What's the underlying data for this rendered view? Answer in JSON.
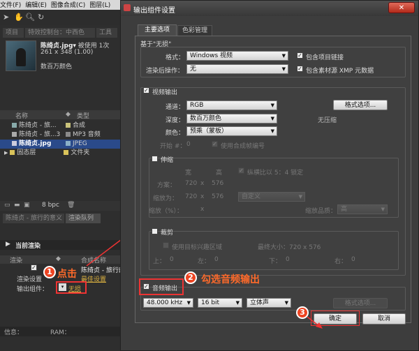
{
  "menubar": {
    "items": [
      "文件(F)",
      "编辑(E)",
      "图像合成(C)",
      "图层(L)"
    ]
  },
  "project": {
    "tabs": [
      "项目",
      "特效控制台：中西色",
      "工具"
    ],
    "file_name": "陈绮贞.jpg",
    "used_text": "被使用 1次",
    "dimensions": "261 x 348 (1.00)",
    "color_depth": "数百万颜色",
    "columns": {
      "name": "名称",
      "type": "类型"
    },
    "items": [
      {
        "name": "陈绮贞 - 旅...",
        "type": "合成",
        "color": "#c9c27a"
      },
      {
        "name": "陈绮贞 - 旅...3",
        "type": "MP3 音频",
        "color": "#8a8a8a"
      },
      {
        "name": "陈绮贞.jpg",
        "type": "JPEG",
        "color": "#8ab0c8"
      },
      {
        "name": "固态层",
        "type": "文件夹",
        "color": "#d9c35a"
      }
    ],
    "bpc": "8 bpc"
  },
  "render_queue": {
    "tabs": [
      "陈绮贞 - 旅行的意义",
      "渲染队列"
    ],
    "current_render": "当前渲染",
    "col_render": "渲染",
    "col_comp": "合成名称",
    "comp_name": "陈绮贞 - 旅行的",
    "render_settings_label": "渲染设置",
    "render_settings_value": "最佳设置",
    "output_module_label": "输出组件：",
    "output_module_value": "无损",
    "info_label": "信息：",
    "ram_label": "RAM："
  },
  "dialog": {
    "title": "输出组件设置",
    "close": "✕",
    "tabs": [
      "主要选项",
      "色彩管理"
    ],
    "based_on": "基于\"无损\"",
    "format_label": "格式：",
    "format_value": "Windows 视频",
    "include_project_link": "包含项目链接",
    "post_render_label": "渲染后操作：",
    "post_render_value": "无",
    "include_xmp": "包含素材源 XMP 元数据",
    "video_output": "视频输出",
    "channels_label": "通道：",
    "channels_value": "RGB",
    "format_options": "格式选项...",
    "depth_label": "深度：",
    "depth_value": "数百万颜色",
    "no_compression": "无压缩",
    "color_label": "颜色：",
    "color_value": "预乘（蒙板）",
    "start_label": "开始 #：",
    "start_value": "0",
    "use_comp_frame": "使用合成帧编号",
    "stretch": "伸缩",
    "width_label": "宽",
    "height_label": "高",
    "lock_ratio": "纵横比以 5：4 锁定",
    "render_at_label": "方案：",
    "render_at_w": "720",
    "render_at_h": "576",
    "stretch_to_label": "缩放为：",
    "stretch_to_w": "720",
    "stretch_to_h": "576",
    "custom": "自定义",
    "stretch_pct_label": "缩放（%）：",
    "stretch_quality_label": "缩放品质：",
    "stretch_quality_value": "高",
    "crop": "裁剪",
    "use_roi": "使用目标兴趣区域",
    "final_size": "最终大小：720 x 576",
    "top_label": "上：",
    "top_value": "0",
    "left_label": "左：",
    "left_value": "0",
    "bottom_label": "下：",
    "bottom_value": "0",
    "right_label": "右：",
    "right_value": "0",
    "audio_output": "音频输出",
    "sample_rate": "48.000 kHz",
    "bit_depth": "16 bit",
    "audio_channels": "立体声",
    "audio_format_options": "格式选项...",
    "ok": "确定",
    "cancel": "取消"
  },
  "annotations": {
    "step1": "1",
    "step1_text": "点击",
    "step2": "2",
    "step2_text": "勾选音频输出",
    "step3": "3"
  }
}
